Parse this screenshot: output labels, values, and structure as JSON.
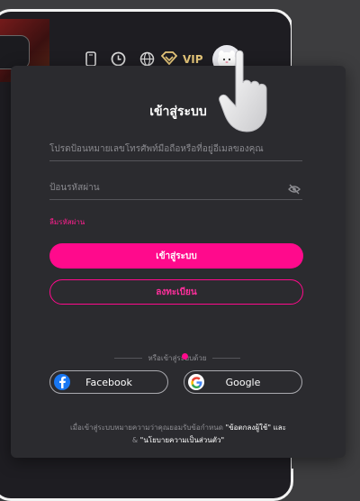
{
  "topbar": {
    "vip_label": "VIP",
    "icons": [
      "phone-icon",
      "clock-icon",
      "globe-icon",
      "vip-diamond-icon",
      "avatar"
    ]
  },
  "login": {
    "title": "เข้าสู่ระบบ",
    "identifier_placeholder": "โปรดป้อนหมายเลขโทรศัพท์มือถือหรือที่อยู่อีเมลของคุณ",
    "password_placeholder": "ป้อนรหัสผ่าน",
    "forgot_password": "ลืมรหัสผ่าน",
    "login_button": "เข้าสู่ระบบ",
    "register_button": "ลงทะเบียน",
    "or_login_with": "หรือเข้าสู่ระบบด้วย",
    "facebook_label": "Facebook",
    "google_label": "Google",
    "terms_prefix": "เมื่อเข้าสู่ระบบหมายความว่าคุณยอมรับข้อกำหนด ",
    "terms_link1": "\"ข้อตกลงผู้ใช้\"",
    "terms_and": " และ",
    "terms_amp": "& ",
    "terms_link2": "\"นโยบายความเป็นส่วนตัว\""
  },
  "colors": {
    "accent": "#ff0a8c",
    "panel": "#2b2b2f",
    "vip_gold": "#e7c77a"
  }
}
